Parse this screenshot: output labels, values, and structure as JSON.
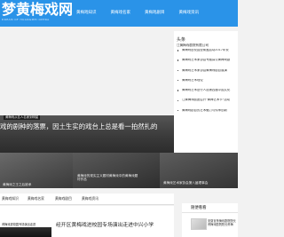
{
  "header": {
    "logo": "梦黄梅戏网",
    "logo_sub": "DREAM OF HUANGMEI OPERA",
    "nav": [
      "黄梅戏知识",
      "黄梅戏名家",
      "黄梅戏剧目",
      "黄梅戏资讯"
    ]
  },
  "sidebar": {
    "title": "头条",
    "subtitle": "江黄梅戏剧院有限公司",
    "items": [
      "黄梅戏进校园全覆盖启动2017年安",
      "黄梅戏艺术家协会专题探讨黄梅戏剧",
      "黄梅戏艺术家协会黄梅戏剧目展演",
      "黄梅戏艺术理论",
      "黄梅戏艺术进行人选第四届中国文化",
      "江黄梅戏剧团召开\"黄梅艺术节\"活动",
      "黄梅戏剧目的艺术魅力与传承创新"
    ]
  },
  "banner": {
    "tag": "黄梅戏从名人名家到明星",
    "text": "戏的剧种的落票，因土生实的戏台上总是看一拍然扎的"
  },
  "tiles": {
    "a_caption": "黄梅戏之王之后被承",
    "b_caption": "黄梅戏的现实主义题材黄梅戏中的黄梅戏题材作品",
    "c_caption": "黄梅戏艺术家协会第八届理事会"
  },
  "tabs": [
    "黄梅戏知识",
    "黄梅戏名家",
    "黄梅戏剧目",
    "黄梅戏资讯"
  ],
  "article": {
    "thumb_label": "黄梅戏进校园专场演出走进",
    "title": "经开区黄梅戏进校园专场演出走进中兴小学"
  },
  "recommend": {
    "title": "随便看看",
    "text": "安徽省黄梅戏剧院院长 黄梅戏剧院院长黄梅"
  }
}
